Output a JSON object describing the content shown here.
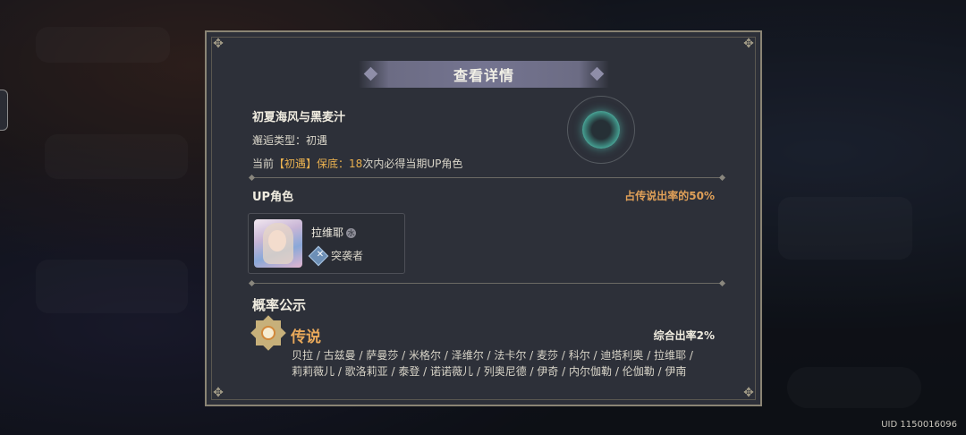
{
  "dialog": {
    "title": "查看详情",
    "banner_name": "初夏海风与黑麦汁",
    "encounter_type_label": "邂逅类型：",
    "encounter_type_value": "初遇",
    "pity_prefix": "当前",
    "pity_tag": "【初遇】保底：",
    "pity_count": "18",
    "pity_suffix": "次内必得当期UP角色"
  },
  "up_section": {
    "label": "UP角色",
    "rate_text": "占传说出率的50%",
    "character": {
      "name": "拉维耶",
      "badge": "水",
      "class_icon": "assault-icon",
      "class_name": "突袭者"
    }
  },
  "probability": {
    "title": "概率公示",
    "rarity_icon": "legend-rarity-icon",
    "rarity_name": "传说",
    "rarity_rate": "综合出率2%",
    "characters_line1": "贝拉 / 古兹曼 / 萨曼莎 / 米格尔 / 泽维尔 / 法卡尔 / 麦莎 / 科尔 / 迪塔利奥 / 拉维耶 /",
    "characters_line2": "莉莉薇儿 / 歌洛莉亚 / 泰登 / 诺诺薇儿 / 列奥尼德 / 伊奇 / 内尔伽勒 / 伦伽勒 / 伊南"
  },
  "footer": {
    "uid": "UID 1150016096"
  },
  "colors": {
    "dialog_bg": "#2d3039",
    "gold_accent": "#e9b04f",
    "up_rate": "#e0a058",
    "orb_glow": "#6fe0cc"
  }
}
